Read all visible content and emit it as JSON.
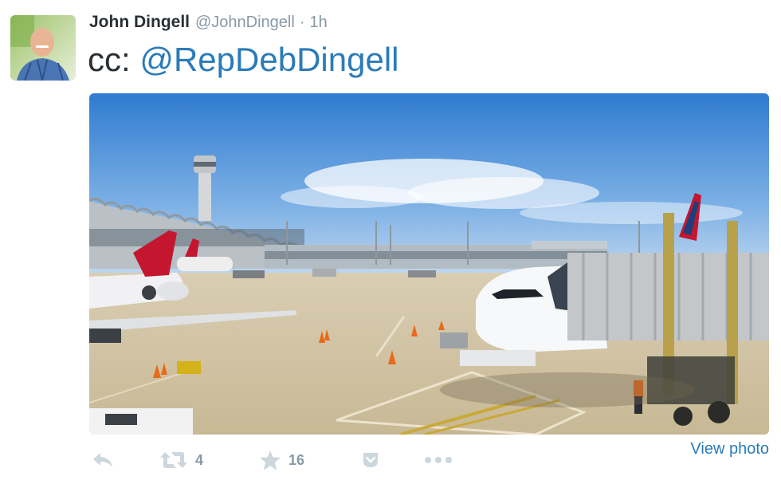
{
  "tweet": {
    "author_name": "John Dingell",
    "author_handle": "@JohnDingell",
    "separator": "·",
    "time": "1h",
    "text_prefix": "cc: ",
    "mention": "@RepDebDingell",
    "view_photo_label": "View photo"
  },
  "actions": {
    "retweet_count": "4",
    "favorite_count": "16"
  },
  "icons": {
    "reply": "reply-icon",
    "retweet": "retweet-icon",
    "favorite": "star-icon",
    "pocket": "pocket-icon",
    "more": "more-icon"
  },
  "colors": {
    "link": "#2b7bb9",
    "text": "#292f33",
    "muted": "#8899a6",
    "icon": "#ccd6dd"
  }
}
